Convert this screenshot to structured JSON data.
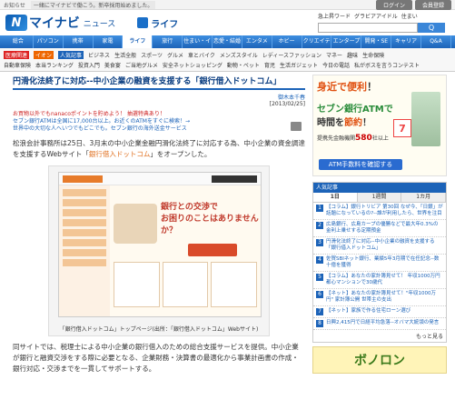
{
  "topbar": {
    "label": "お知らせ",
    "notice": "一緒にマイナビで働こう。新卒採用始めました。",
    "login": "ログイン",
    "register": "会員登録"
  },
  "header": {
    "logo_mark": "N",
    "logo_text": "マイナビ",
    "logo_news": "ニュース",
    "section": "ライフ"
  },
  "search": {
    "label": "急上昇ワード",
    "words": [
      "グラビアアイドル",
      "住まい"
    ],
    "button": "Q"
  },
  "nav": [
    "総合",
    "パソコン",
    "携帯",
    "家電",
    "ライフ",
    "旅行",
    "住まい・インテリア",
    "恋愛・結婚",
    "エンタメ",
    "ホビー",
    "クリエイティブ",
    "エンタープライズ",
    "開発・SE",
    "キャリア",
    "Q&A"
  ],
  "nav_active": "ライフ",
  "subnav": {
    "row1": [
      {
        "t": "医療関連",
        "k": "red"
      },
      {
        "t": "イオン",
        "k": "org"
      },
      {
        "t": "人気記事",
        "k": "blu"
      },
      "ビジネス",
      "生活全般",
      "スポーツ",
      "グルメ",
      "車とバイク",
      "メンズスタイル",
      "レディースファッション",
      "マネー",
      "趣味",
      "生命保険"
    ],
    "row2": [
      "自動車保険",
      "本当ランキング",
      "投資入門",
      "美食宴",
      "ご当地グルメ",
      "安全ネットショッピング",
      "動物・ペット",
      "育児",
      "生活ガジェット",
      "今日の電話",
      "私がボスを言うコンテスト"
    ]
  },
  "article": {
    "title": "円滑化法終了に対応--中小企業の融資を支援する「銀行借入ドットコム」",
    "author": "御木本千春",
    "date": "[2013/02/25]",
    "promos": [
      "お買物以外でもnanacoポイントを貯めよう！ 抽選特典あり！",
      "セブン銀行ATMは全国に17,000台以上。お近くのATMをすぐに検索！→",
      "世界中の大切な人へいつでもどこでも。セブン銀行の海外送金サービス"
    ],
    "body1": "松浪会計事務所は25日、3月末の中小企業金融円滑化法終了に対応する為、中小企業の資金調達を支援するWebサイト「",
    "body1_link": "銀行借入ドットコム",
    "body1_end": "」をオープンした。",
    "hero_text": "銀行との交渉で\nお困りのことはありませんか？",
    "caption": "「銀行借入ドットコム」トップページ(出所：「銀行借入ドットコム」Webサイト)",
    "body2": "同サイトでは、税理士による中小企業の銀行借入のための総合支援サービスを提供。中小企業が銀行と融資交渉をする際に必要となる、企業財務・決算書の最適化から事業計画書の作成・銀行対応・交渉までを一貫してサポートする。"
  },
  "ad": {
    "line1a": "身近で",
    "line1b": "便利",
    "line2": "セブン銀行ATMで",
    "line3a": "時間を",
    "line3b": "節約",
    "line4a": "提携先金融機関",
    "line4b": "580",
    "line4c": "社以上",
    "button": "ATM手数料を確認する",
    "logo7": "7"
  },
  "ranking": {
    "title": "人気記事",
    "tabs": [
      "1日",
      "1週間",
      "1カ月"
    ],
    "active_tab": "1日",
    "items": [
      {
        "n": "1",
        "t": "【コラム】銀行トリビア 第30回 なぜ今、「日銀」が話題になっているの?--誰が利用したら、世界を注目"
      },
      {
        "n": "2",
        "t": "広島銀行、広島カープの優勝などで最大年0.3%の金利上乗せする定期預金"
      },
      {
        "n": "3",
        "t": "円滑化法終了に対応--中小企業の融資を支援する「銀行借入ドットコム」"
      },
      {
        "n": "4",
        "t": "佐賀SBIネット銀行、業績5年3月期で在任記念--数十億を獲得"
      },
      {
        "n": "5",
        "t": "【コラム】あなたの家計簿見せて！ 年収1000万円 都心マンションで30歳代"
      },
      {
        "n": "6",
        "t": "【ネット】あなたの家計簿見せて！\"年収1000万円\" 家計簿公開 世帯主の支出"
      },
      {
        "n": "7",
        "t": "【ネット】家族で作る住宅ローン選び"
      },
      {
        "n": "8",
        "t": "日興2,415円で日経平均急落--オバマ大統領の発言"
      }
    ],
    "more": "もっと見る"
  },
  "ad2": {
    "text": "ボノロン"
  }
}
